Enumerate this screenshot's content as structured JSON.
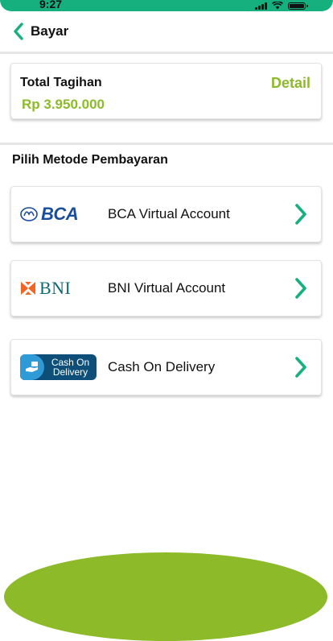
{
  "status_bar": {
    "time": "9:27",
    "color": "#16b07f"
  },
  "header": {
    "back_icon": "chevron-left-icon",
    "title": "Bayar"
  },
  "total": {
    "label": "Total Tagihan",
    "amount": "Rp 3.950.000",
    "detail_link": "Detail",
    "accent_color": "#8cba28"
  },
  "payment": {
    "section_title": "Pilih Metode Pembayaran",
    "methods": [
      {
        "logo": "bca-logo",
        "logo_text": "BCA",
        "label": "BCA Virtual Account",
        "icon": "chevron-right-icon"
      },
      {
        "logo": "bni-logo",
        "logo_text": "BNI",
        "label": "BNI Virtual Account",
        "icon": "chevron-right-icon"
      },
      {
        "logo": "cod-logo",
        "logo_text": "Cash On Delivery",
        "label": "Cash On Delivery",
        "icon": "chevron-right-icon"
      }
    ]
  },
  "theme": {
    "primary": "#16b07f",
    "accent": "#8cba28"
  }
}
